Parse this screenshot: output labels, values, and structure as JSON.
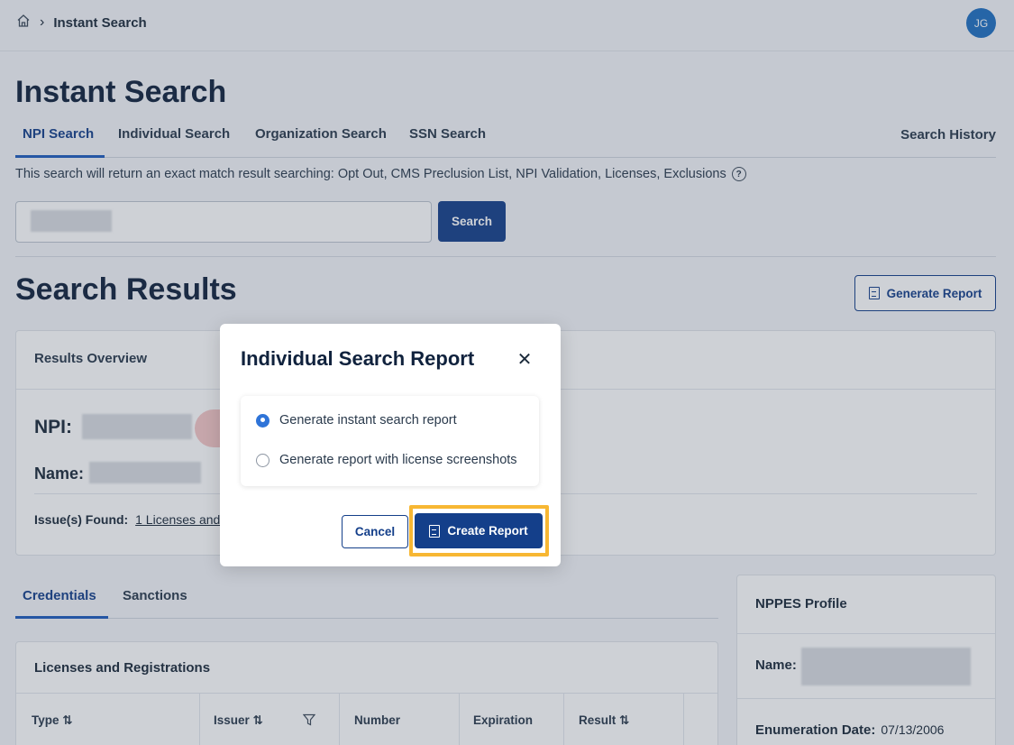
{
  "breadcrumb": {
    "current": "Instant Search"
  },
  "user": {
    "initials": "JG"
  },
  "page": {
    "title": "Instant Search"
  },
  "tabs": [
    {
      "label": "NPI Search",
      "active": true
    },
    {
      "label": "Individual Search",
      "active": false
    },
    {
      "label": "Organization Search",
      "active": false
    },
    {
      "label": "SSN Search",
      "active": false
    }
  ],
  "search_history_label": "Search History",
  "help_text": "This search will return an exact match result searching: Opt Out, CMS Preclusion List, NPI Validation, Licenses, Exclusions",
  "search": {
    "button_label": "Search",
    "value": ""
  },
  "results": {
    "title": "Search Results",
    "generate_report_label": "Generate Report",
    "overview_title": "Results Overview",
    "npi_label": "NPI:",
    "name_label": "Name:",
    "issues_label": "Issue(s) Found:",
    "issues_link": "1 Licenses and"
  },
  "sub_tabs": [
    {
      "label": "Credentials",
      "active": true
    },
    {
      "label": "Sanctions",
      "active": false
    }
  ],
  "licenses": {
    "title": "Licenses and Registrations",
    "columns": [
      "Type ⇅",
      "Issuer ⇅",
      "Number",
      "Expiration",
      "Result ⇅"
    ]
  },
  "nppes": {
    "title": "NPPES Profile",
    "name_label": "Name:",
    "enumeration_label": "Enumeration Date:",
    "enumeration_value": "07/13/2006"
  },
  "modal": {
    "title": "Individual Search Report",
    "options": [
      {
        "label": "Generate instant search report",
        "selected": true
      },
      {
        "label": "Generate report with license screenshots",
        "selected": false
      }
    ],
    "cancel_label": "Cancel",
    "create_label": "Create Report"
  },
  "colors": {
    "primary": "#143f8a",
    "accent": "#2f74d8",
    "highlight": "#f7b733"
  }
}
